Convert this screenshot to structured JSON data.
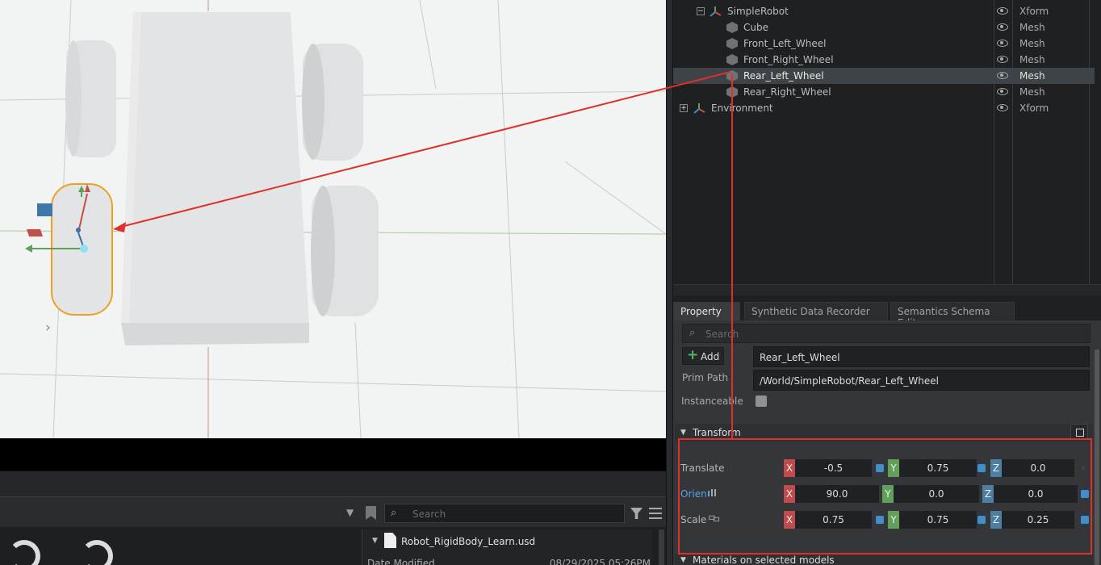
{
  "stage": {
    "rows": [
      {
        "name": "SimpleRobot",
        "type": "Xform",
        "expander": "−"
      },
      {
        "name": "Cube",
        "type": "Mesh"
      },
      {
        "name": "Front_Left_Wheel",
        "type": "Mesh"
      },
      {
        "name": "Front_Right_Wheel",
        "type": "Mesh"
      },
      {
        "name": "Rear_Left_Wheel",
        "type": "Mesh"
      },
      {
        "name": "Rear_Right_Wheel",
        "type": "Mesh"
      },
      {
        "name": "Environment",
        "type": "Xform",
        "expander": "+"
      }
    ]
  },
  "property": {
    "tabs": [
      "Property",
      "Synthetic Data Recorder",
      "Semantics Schema Editor"
    ],
    "search_placeholder": "Search",
    "add_label": "Add",
    "prim_name": "Rear_Left_Wheel",
    "prim_path_label": "Prim Path",
    "prim_path": "/World/SimpleRobot/Rear_Left_Wheel",
    "instanceable_label": "Instanceable",
    "transform_title": "Transform",
    "translate": {
      "label": "Translate",
      "x": "-0.5",
      "y": "0.75",
      "z": "0.0"
    },
    "orient": {
      "label": "Orien",
      "x": "90.0",
      "y": "0.0",
      "z": "0.0"
    },
    "scale": {
      "label": "Scale",
      "x": "0.75",
      "y": "0.75",
      "z": "0.25"
    },
    "axis_labels": {
      "x": "X",
      "y": "Y",
      "z": "Z"
    },
    "materials_title": "Materials on selected models"
  },
  "content_browser": {
    "search_placeholder": "Search",
    "file_name": "Robot_RigidBody_Learn.usd",
    "date_label": "Date Modified",
    "date_value": "08/29/2025 05:26PM"
  },
  "colors": {
    "annotation": "#e0302a",
    "selection": "#f0a020",
    "accent": "#3f8fcb"
  }
}
